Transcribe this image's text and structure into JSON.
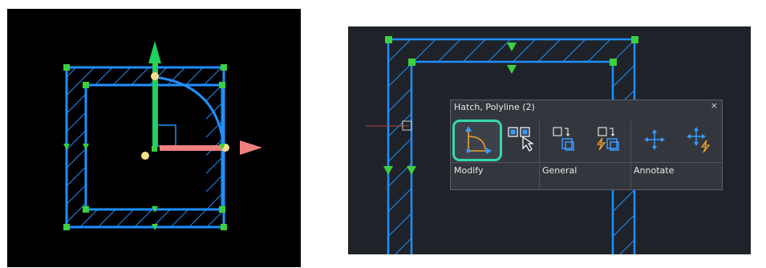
{
  "palette": {
    "title": "Hatch, Polyline (2)",
    "close_label": "×",
    "groups": [
      {
        "label": "Modify"
      },
      {
        "label": "General"
      },
      {
        "label": "Annotate"
      }
    ],
    "tools": [
      {
        "name": "modify-tool",
        "icon": "arc-radius-edit-icon",
        "selected": true
      },
      {
        "name": "select-similar-tool",
        "icon": "select-cursor-icon"
      },
      {
        "name": "copy-tool",
        "icon": "copy-icon"
      },
      {
        "name": "copy-with-base-tool",
        "icon": "copy-lightning-icon"
      },
      {
        "name": "move-tool",
        "icon": "move-arrows-icon"
      },
      {
        "name": "move-lightning-tool",
        "icon": "move-lightning-icon"
      }
    ]
  },
  "colors": {
    "hatch_blue": "#1e90ff",
    "grip_green": "#3cd040",
    "y_axis": "#20d060",
    "x_axis": "#f08080",
    "selection_accent": "#34d9a9",
    "canvas_dark": "#1f2329"
  }
}
